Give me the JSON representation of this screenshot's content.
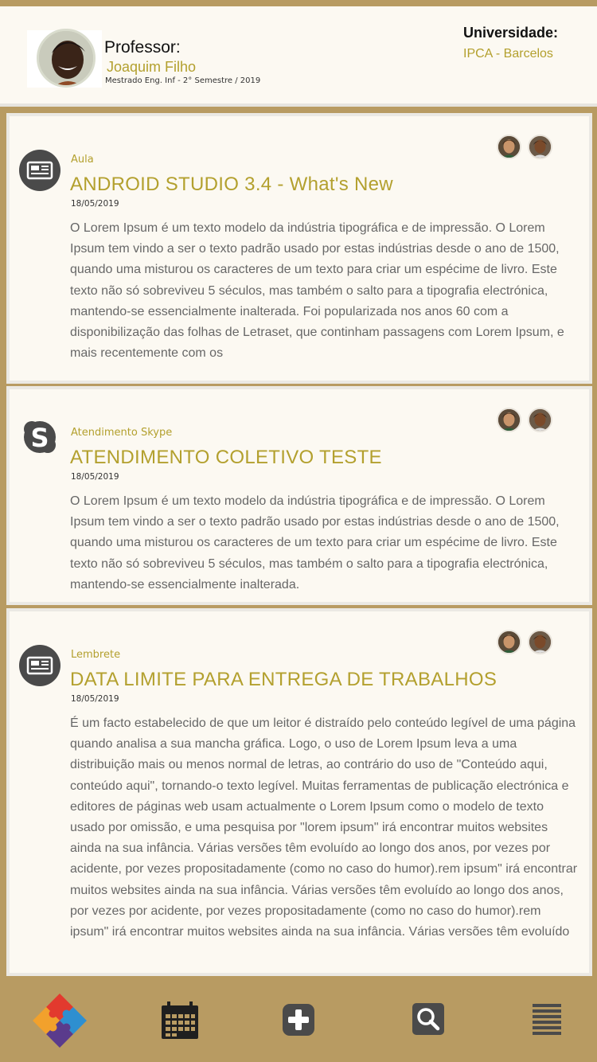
{
  "header": {
    "professor_label": "Professor:",
    "professor_name": "Joaquim Filho",
    "professor_sub": "Mestrado Eng. Inf - 2° Semestre / 2019",
    "university_label": "Universidade:",
    "university_value": "IPCA - Barcelos"
  },
  "posts": [
    {
      "icon": "newspaper-icon",
      "category": "Aula",
      "title": "ANDROID STUDIO 3.4 - What's New",
      "date": "18/05/2019",
      "body": "O Lorem Ipsum é um texto modelo da indústria tipográfica e de impressão. O Lorem Ipsum tem vindo a ser o texto padrão usado por estas indústrias desde o ano de 1500, quando uma misturou os caracteres de um texto para criar um espécime de livro. Este texto não só sobreviveu 5 séculos, mas também o salto para a tipografia electrónica, mantendo-se essencialmente inalterada. Foi popularizada nos anos 60 com a disponibilização das folhas de Letraset, que continham passagens com Lorem Ipsum, e mais recentemente com os"
    },
    {
      "icon": "skype-icon",
      "category": "Atendimento Skype",
      "title": "ATENDIMENTO COLETIVO TESTE",
      "date": "18/05/2019",
      "body": "O Lorem Ipsum é um texto modelo da indústria tipográfica e de impressão. O Lorem Ipsum tem vindo a ser o texto padrão usado por estas indústrias desde o ano de 1500, quando uma misturou os caracteres de um texto para criar um espécime de livro. Este texto não só sobreviveu 5 séculos, mas também o salto para a tipografia electrónica, mantendo-se essencialmente inalterada."
    },
    {
      "icon": "newspaper-icon",
      "category": "Lembrete",
      "title": "DATA LIMITE PARA ENTREGA DE TRABALHOS",
      "date": "18/05/2019",
      "body": "É um facto estabelecido de que um leitor é distraído pelo conteúdo legível de uma página quando analisa a sua mancha gráfica. Logo, o uso de Lorem Ipsum leva a uma distribuição mais ou menos normal de letras, ao contrário do uso de \"Conteúdo aqui, conteúdo aqui\", tornando-o texto legível. Muitas ferramentas de publicação electrónica e editores de páginas web usam actualmente o Lorem Ipsum como o modelo de texto usado por omissão, e uma pesquisa por \"lorem ipsum\" irá encontrar muitos websites ainda na sua infância. Várias versões têm evoluído ao longo dos anos, por vezes por acidente, por vezes propositadamente (como no caso do humor).rem ipsum\" irá encontrar muitos websites ainda na sua infância. Várias versões têm evoluído ao longo dos anos, por vezes por acidente, por vezes propositadamente (como no caso do humor).rem ipsum\" irá encontrar muitos websites ainda na sua infância. Várias versões têm evoluído"
    }
  ],
  "nav": [
    {
      "icon": "puzzle-logo-icon"
    },
    {
      "icon": "calendar-icon"
    },
    {
      "icon": "add-icon"
    },
    {
      "icon": "search-icon"
    },
    {
      "icon": "menu-icon"
    }
  ],
  "colors": {
    "accent": "#b3a02e",
    "bar": "#b89b62",
    "card": "#fcf9f2",
    "body_text": "#676767"
  }
}
